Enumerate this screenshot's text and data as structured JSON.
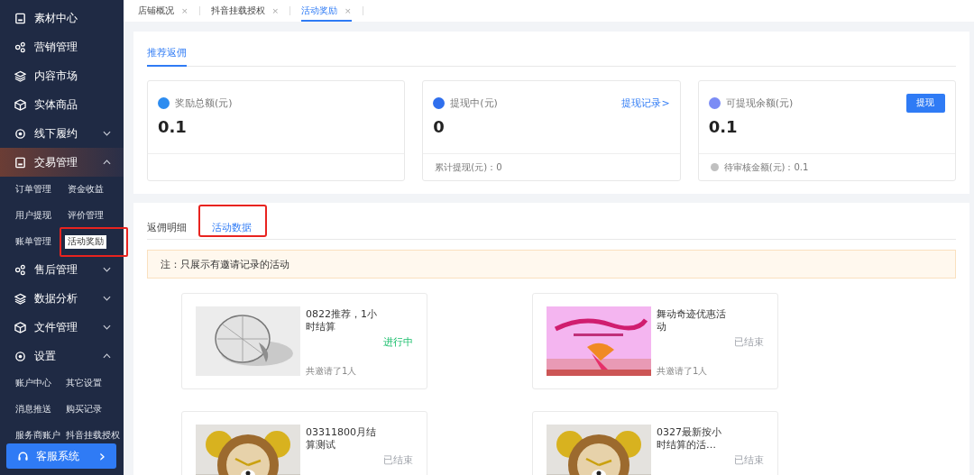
{
  "sidebar": {
    "items": [
      {
        "label": "素材中心",
        "selected": false
      },
      {
        "label": "营销管理",
        "selected": false
      },
      {
        "label": "内容市场",
        "selected": false
      },
      {
        "label": "实体商品",
        "selected": false
      },
      {
        "label": "线下履约",
        "selected": false,
        "expanded": false
      },
      {
        "label": "交易管理",
        "selected": true,
        "expanded": true,
        "children": [
          {
            "label": "订单管理",
            "selected": false,
            "annotated": false
          },
          {
            "label": "资金收益",
            "selected": false,
            "annotated": false
          },
          {
            "label": "用户提现",
            "selected": false,
            "annotated": false
          },
          {
            "label": "评价管理",
            "selected": false,
            "annotated": false
          },
          {
            "label": "账单管理",
            "selected": false,
            "annotated": false
          },
          {
            "label": "活动奖励",
            "selected": true,
            "annotated": true
          }
        ]
      },
      {
        "label": "售后管理",
        "selected": false,
        "expanded": false
      },
      {
        "label": "数据分析",
        "selected": false,
        "expanded": false
      },
      {
        "label": "文件管理",
        "selected": false,
        "expanded": false
      },
      {
        "label": "设置",
        "selected": false,
        "expanded": true,
        "children": [
          {
            "label": "账户中心",
            "selected": false,
            "annotated": false
          },
          {
            "label": "其它设置",
            "selected": false,
            "annotated": false
          },
          {
            "label": "消息推送",
            "selected": false,
            "annotated": false
          },
          {
            "label": "购买记录",
            "selected": false,
            "annotated": false
          },
          {
            "label": "服务商账户",
            "selected": false,
            "annotated": false
          },
          {
            "label": "抖音挂载授权",
            "selected": false,
            "annotated": false
          }
        ]
      }
    ],
    "support_button": {
      "label": "客服系统",
      "arrow": "›"
    }
  },
  "page_tabs": [
    {
      "label": "店铺概况",
      "selected": false,
      "close": "×"
    },
    {
      "label": "抖音挂载授权",
      "selected": false,
      "close": "×"
    },
    {
      "label": "活动奖励",
      "selected": true,
      "close": "×"
    }
  ],
  "summary": {
    "tab": "推荐返佣",
    "cards": [
      {
        "title": "奖励总额(元)",
        "value": "0.1",
        "color": "#2d8cf0"
      },
      {
        "title": "提现中(元)",
        "value": "0",
        "link": "提现记录>",
        "footer": "累计提现(元)：0",
        "color": "#2f6fed"
      },
      {
        "title": "可提现余额(元)",
        "value": "0.1",
        "button": "提现",
        "footer": "待审核金额(元)：0.1",
        "color": "#7b8cf5"
      }
    ]
  },
  "details": {
    "tabs": [
      {
        "label": "返佣明细",
        "selected": false,
        "annotated": false
      },
      {
        "label": "活动数据",
        "selected": true,
        "annotated": true
      }
    ],
    "notice": "注：只展示有邀请记录的活动",
    "activities": [
      {
        "title": "0822推荐，1小时结算",
        "status": "进行中",
        "kind": "ongoing",
        "invited": "共邀请了1人"
      },
      {
        "title": "舞动奇迹优惠活动",
        "status": "已结束",
        "kind": "ended",
        "invited": "共邀请了1人"
      },
      {
        "title": "03311800月结算测试",
        "status": "已结束",
        "kind": "ended"
      },
      {
        "title": "0327最新按小时结算的活…",
        "status": "已结束",
        "kind": "ended"
      }
    ]
  }
}
